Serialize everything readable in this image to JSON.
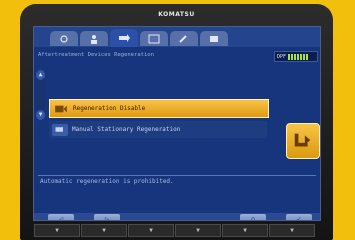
{
  "brand": "KOMATSU",
  "header": {
    "title": "Aftertreatment Devices Regeneration"
  },
  "battery": {
    "label": "DPF"
  },
  "menu": [
    {
      "label": "Regeneration Disable"
    },
    {
      "label": "Manual Stationary Regeneration"
    }
  ],
  "message": "Automatic regeneration is prohibited.",
  "bottom_buttons": [
    "◁",
    "▷",
    "",
    "",
    "⌂",
    "✓"
  ],
  "hard_keys": [
    "▼",
    "▼",
    "▼",
    "▼",
    "▼",
    "▼"
  ],
  "colors": {
    "background": "#f2c00c",
    "screen": "#16357c",
    "highlight": "#f8c24a"
  },
  "icons": [
    "arrow-left-icon",
    "arrow-right-icon",
    "home-icon",
    "check-icon",
    "regeneration-icon",
    "stationary-regeneration-icon"
  ]
}
